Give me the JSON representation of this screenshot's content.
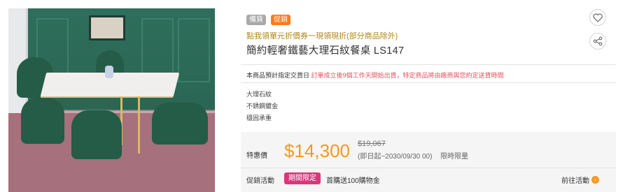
{
  "badges": {
    "grey": "備貨",
    "orange": "促銷"
  },
  "promo_link": "點我領單元折價券一現領現折(部分商品除外)",
  "title": "簡約輕奢鐵藝大理石紋餐桌 LS147",
  "shipping": {
    "prefix": "本商品預計指定交貨日",
    "detail": "訂單成立後9個工作天開始出貨，特定商品將由廠商與您約定送貨時間"
  },
  "specs": [
    "大理石紋",
    "不銹鋼鍍金",
    "穩固承重"
  ],
  "price": {
    "label": "特惠價",
    "current": "$14,300",
    "original": "$19,067",
    "period": "(即日起~2030/09/30 00)",
    "limit": "限時限量"
  },
  "promotion": {
    "label": "促銷活動",
    "tag": "期間限定",
    "desc": "首購送100購物金",
    "goto": "前往活動"
  },
  "icons": {
    "heart": "heart-icon",
    "share": "share-icon",
    "arrow": "chevron-right-icon"
  },
  "colors": {
    "price": "#f39a1f",
    "accent_tag": "#d9377b",
    "ship_red": "#e4505a",
    "promo_link": "#b0851f"
  }
}
